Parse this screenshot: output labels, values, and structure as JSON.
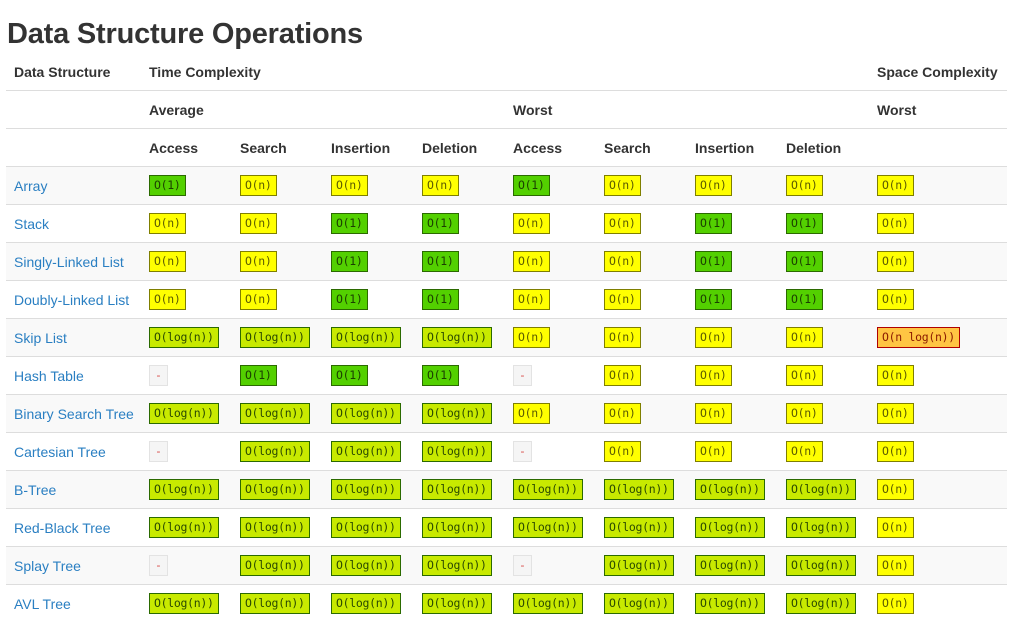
{
  "page": {
    "title": "Data Structure Operations"
  },
  "header": {
    "data_structure": "Data Structure",
    "time_complexity": "Time Complexity",
    "space_complexity": "Space Complexity",
    "average": "Average",
    "worst": "Worst",
    "space_worst": "Worst",
    "ops": [
      "Access",
      "Search",
      "Insertion",
      "Deletion",
      "Access",
      "Search",
      "Insertion",
      "Deletion"
    ]
  },
  "colors": {
    "good": "#53d000",
    "fair": "#c8ea00",
    "bad": "#ffff00",
    "worse": "#ffc543",
    "link": "#2a7fc2"
  },
  "rows": [
    {
      "name": "Array",
      "cells": [
        [
          "O(1)",
          "good"
        ],
        [
          "O(n)",
          "bad"
        ],
        [
          "O(n)",
          "bad"
        ],
        [
          "O(n)",
          "bad"
        ],
        [
          "O(1)",
          "good"
        ],
        [
          "O(n)",
          "bad"
        ],
        [
          "O(n)",
          "bad"
        ],
        [
          "O(n)",
          "bad"
        ],
        [
          "O(n)",
          "bad"
        ]
      ]
    },
    {
      "name": "Stack",
      "cells": [
        [
          "O(n)",
          "bad"
        ],
        [
          "O(n)",
          "bad"
        ],
        [
          "O(1)",
          "good"
        ],
        [
          "O(1)",
          "good"
        ],
        [
          "O(n)",
          "bad"
        ],
        [
          "O(n)",
          "bad"
        ],
        [
          "O(1)",
          "good"
        ],
        [
          "O(1)",
          "good"
        ],
        [
          "O(n)",
          "bad"
        ]
      ]
    },
    {
      "name": "Singly-Linked List",
      "cells": [
        [
          "O(n)",
          "bad"
        ],
        [
          "O(n)",
          "bad"
        ],
        [
          "O(1)",
          "good"
        ],
        [
          "O(1)",
          "good"
        ],
        [
          "O(n)",
          "bad"
        ],
        [
          "O(n)",
          "bad"
        ],
        [
          "O(1)",
          "good"
        ],
        [
          "O(1)",
          "good"
        ],
        [
          "O(n)",
          "bad"
        ]
      ]
    },
    {
      "name": "Doubly-Linked List",
      "cells": [
        [
          "O(n)",
          "bad"
        ],
        [
          "O(n)",
          "bad"
        ],
        [
          "O(1)",
          "good"
        ],
        [
          "O(1)",
          "good"
        ],
        [
          "O(n)",
          "bad"
        ],
        [
          "O(n)",
          "bad"
        ],
        [
          "O(1)",
          "good"
        ],
        [
          "O(1)",
          "good"
        ],
        [
          "O(n)",
          "bad"
        ]
      ]
    },
    {
      "name": "Skip List",
      "cells": [
        [
          "O(log(n))",
          "fair"
        ],
        [
          "O(log(n))",
          "fair"
        ],
        [
          "O(log(n))",
          "fair"
        ],
        [
          "O(log(n))",
          "fair"
        ],
        [
          "O(n)",
          "bad"
        ],
        [
          "O(n)",
          "bad"
        ],
        [
          "O(n)",
          "bad"
        ],
        [
          "O(n)",
          "bad"
        ],
        [
          "O(n log(n))",
          "worse"
        ]
      ]
    },
    {
      "name": "Hash Table",
      "cells": [
        [
          "-",
          "na"
        ],
        [
          "O(1)",
          "good"
        ],
        [
          "O(1)",
          "good"
        ],
        [
          "O(1)",
          "good"
        ],
        [
          "-",
          "na"
        ],
        [
          "O(n)",
          "bad"
        ],
        [
          "O(n)",
          "bad"
        ],
        [
          "O(n)",
          "bad"
        ],
        [
          "O(n)",
          "bad"
        ]
      ]
    },
    {
      "name": "Binary Search Tree",
      "cells": [
        [
          "O(log(n))",
          "fair"
        ],
        [
          "O(log(n))",
          "fair"
        ],
        [
          "O(log(n))",
          "fair"
        ],
        [
          "O(log(n))",
          "fair"
        ],
        [
          "O(n)",
          "bad"
        ],
        [
          "O(n)",
          "bad"
        ],
        [
          "O(n)",
          "bad"
        ],
        [
          "O(n)",
          "bad"
        ],
        [
          "O(n)",
          "bad"
        ]
      ]
    },
    {
      "name": "Cartesian Tree",
      "cells": [
        [
          "-",
          "na"
        ],
        [
          "O(log(n))",
          "fair"
        ],
        [
          "O(log(n))",
          "fair"
        ],
        [
          "O(log(n))",
          "fair"
        ],
        [
          "-",
          "na"
        ],
        [
          "O(n)",
          "bad"
        ],
        [
          "O(n)",
          "bad"
        ],
        [
          "O(n)",
          "bad"
        ],
        [
          "O(n)",
          "bad"
        ]
      ]
    },
    {
      "name": "B-Tree",
      "cells": [
        [
          "O(log(n))",
          "fair"
        ],
        [
          "O(log(n))",
          "fair"
        ],
        [
          "O(log(n))",
          "fair"
        ],
        [
          "O(log(n))",
          "fair"
        ],
        [
          "O(log(n))",
          "fair"
        ],
        [
          "O(log(n))",
          "fair"
        ],
        [
          "O(log(n))",
          "fair"
        ],
        [
          "O(log(n))",
          "fair"
        ],
        [
          "O(n)",
          "bad"
        ]
      ]
    },
    {
      "name": "Red-Black Tree",
      "cells": [
        [
          "O(log(n))",
          "fair"
        ],
        [
          "O(log(n))",
          "fair"
        ],
        [
          "O(log(n))",
          "fair"
        ],
        [
          "O(log(n))",
          "fair"
        ],
        [
          "O(log(n))",
          "fair"
        ],
        [
          "O(log(n))",
          "fair"
        ],
        [
          "O(log(n))",
          "fair"
        ],
        [
          "O(log(n))",
          "fair"
        ],
        [
          "O(n)",
          "bad"
        ]
      ]
    },
    {
      "name": "Splay Tree",
      "cells": [
        [
          "-",
          "na"
        ],
        [
          "O(log(n))",
          "fair"
        ],
        [
          "O(log(n))",
          "fair"
        ],
        [
          "O(log(n))",
          "fair"
        ],
        [
          "-",
          "na"
        ],
        [
          "O(log(n))",
          "fair"
        ],
        [
          "O(log(n))",
          "fair"
        ],
        [
          "O(log(n))",
          "fair"
        ],
        [
          "O(n)",
          "bad"
        ]
      ]
    },
    {
      "name": "AVL Tree",
      "cells": [
        [
          "O(log(n))",
          "fair"
        ],
        [
          "O(log(n))",
          "fair"
        ],
        [
          "O(log(n))",
          "fair"
        ],
        [
          "O(log(n))",
          "fair"
        ],
        [
          "O(log(n))",
          "fair"
        ],
        [
          "O(log(n))",
          "fair"
        ],
        [
          "O(log(n))",
          "fair"
        ],
        [
          "O(log(n))",
          "fair"
        ],
        [
          "O(n)",
          "bad"
        ]
      ]
    }
  ]
}
